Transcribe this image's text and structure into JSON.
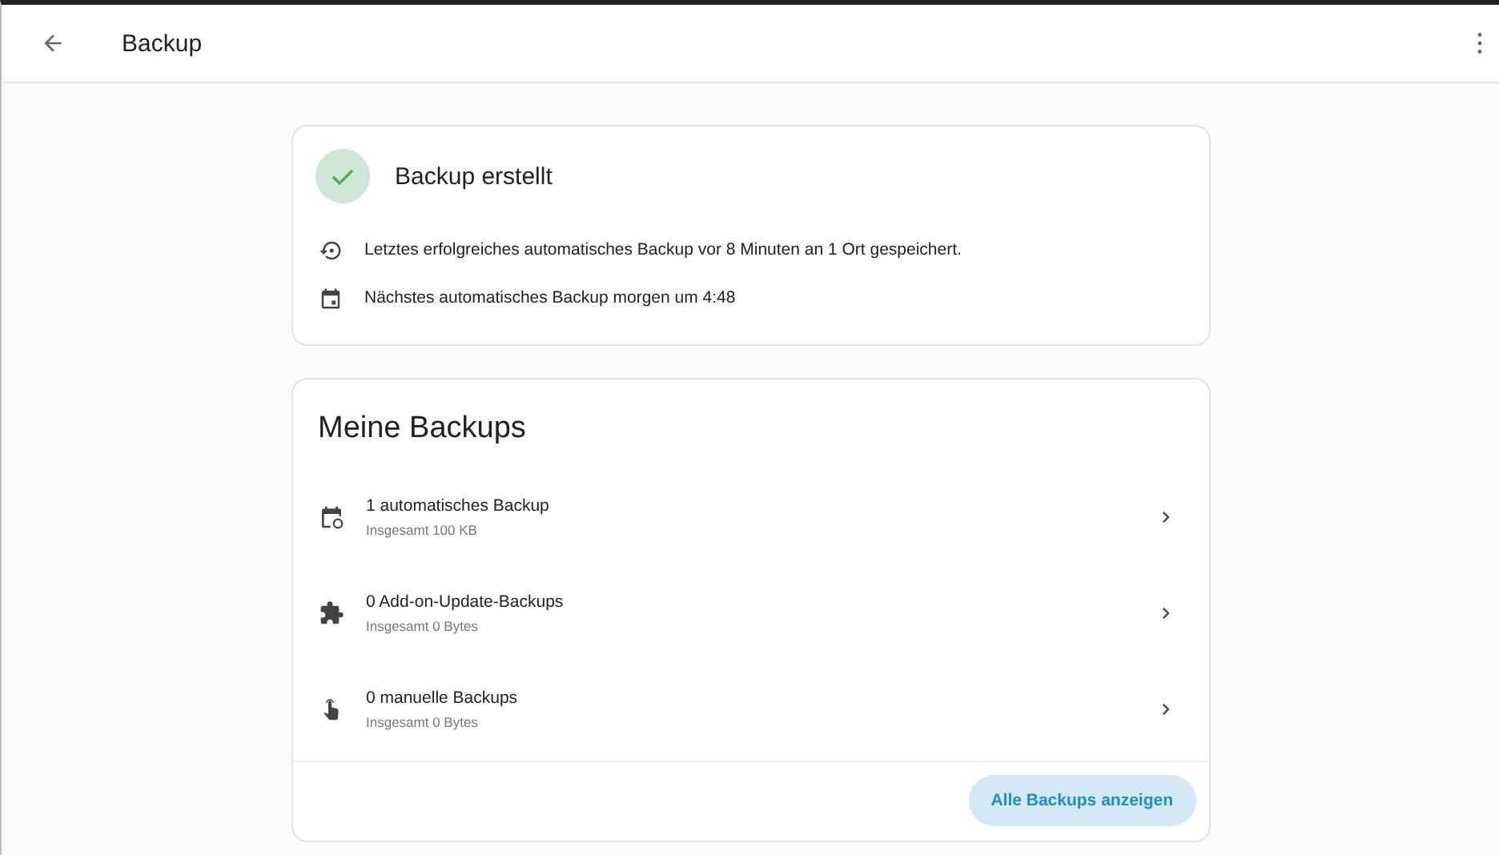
{
  "toolbar": {
    "title": "Backup"
  },
  "status_card": {
    "title": "Backup erstellt",
    "lines": [
      {
        "kind": "history",
        "text": "Letztes erfolgreiches automatisches Backup vor 8 Minuten an 1 Ort gespeichert."
      },
      {
        "kind": "calendar",
        "text": "Nächstes automatisches Backup morgen um 4:48"
      }
    ]
  },
  "backups_card": {
    "title": "Meine Backups",
    "items": [
      {
        "kind": "schedule",
        "title": "1 automatisches Backup",
        "subtitle": "Insgesamt 100 KB"
      },
      {
        "kind": "addon",
        "title": "0 Add-on-Update-Backups",
        "subtitle": "Insgesamt 0 Bytes"
      },
      {
        "kind": "manual",
        "title": "0 manuelle Backups",
        "subtitle": "Insgesamt 0 Bytes"
      }
    ],
    "button": "Alle Backups anzeigen"
  }
}
